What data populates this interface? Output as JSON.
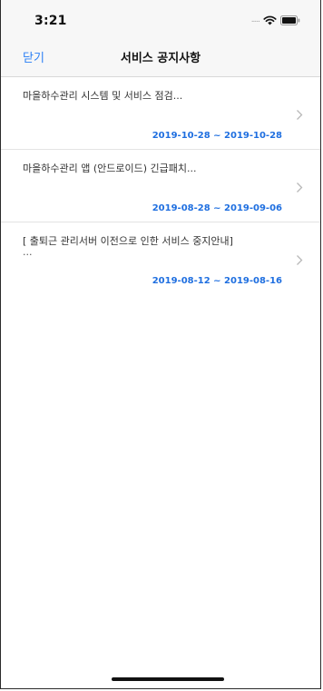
{
  "status_bar": {
    "time": "3:21",
    "signal_text": "....."
  },
  "nav": {
    "close_label": "닫기",
    "title": "서비스 공지사항"
  },
  "notices": [
    {
      "title": "마을하수관리 시스템 및 서비스 점검...",
      "title_line2": "",
      "date": "2019-10-28 ~ 2019-10-28"
    },
    {
      "title": "마을하수관리 앱 (안드로이드) 긴급패치...",
      "title_line2": "",
      "date": "2019-08-28 ~ 2019-09-06"
    },
    {
      "title": "[ 출퇴근 관리서버 이전으로 인한 서비스 중지안내]",
      "title_line2": "...",
      "date": "2019-08-12 ~ 2019-08-16"
    }
  ],
  "colors": {
    "accent": "#2a7ff5",
    "date": "#1f6fe0"
  }
}
